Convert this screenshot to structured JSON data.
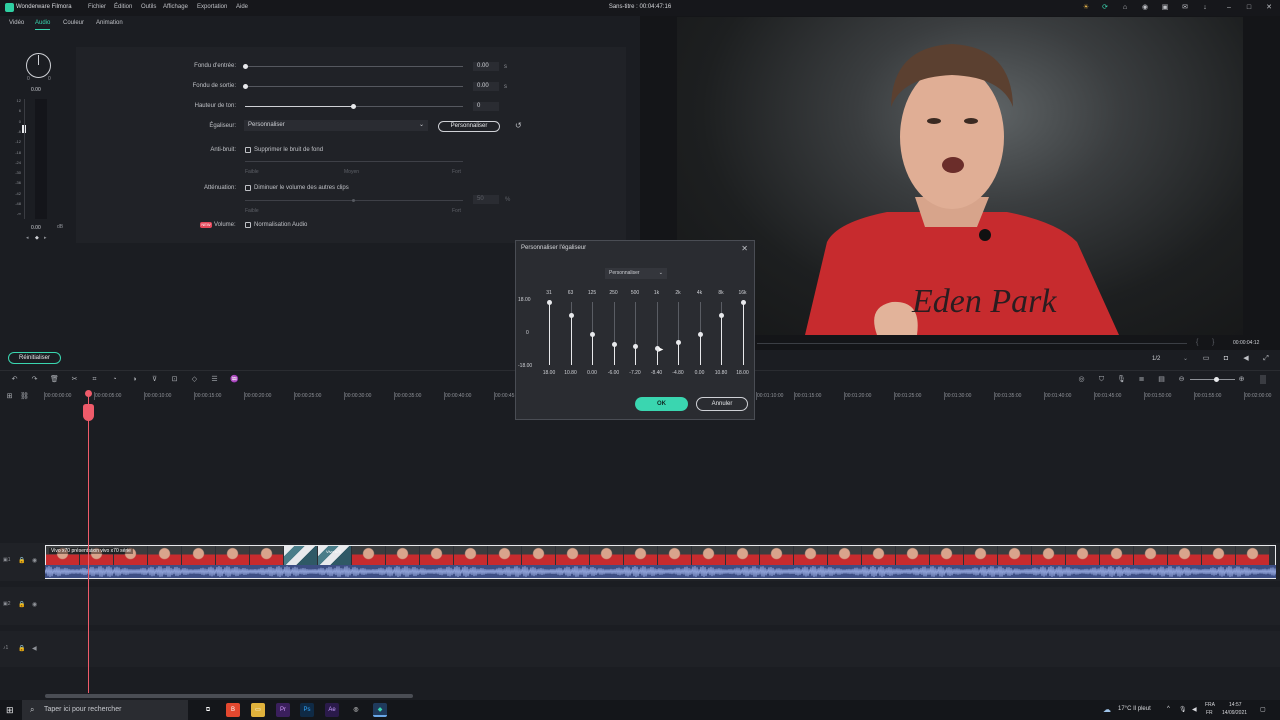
{
  "app": {
    "name": "Wonderware Filmora",
    "doc_title": "Sans-titre : 00:04:47:16",
    "menu": [
      "Fichier",
      "Édition",
      "Outils",
      "Affichage",
      "Exportation",
      "Aide"
    ]
  },
  "tabs": [
    "Vidéo",
    "Audio",
    "Couleur",
    "Animation"
  ],
  "active_tab": "Audio",
  "vu": {
    "value_top": "0.00",
    "value_bottom": "0.00",
    "db_unit": "dB",
    "scale": [
      "12",
      "6",
      "0",
      "-6",
      "-12",
      "-18",
      "-24",
      "-30",
      "-36",
      "-42",
      "-48",
      "-∞"
    ],
    "knob_left": "0",
    "knob_right": "0"
  },
  "audio": {
    "fade_in_label": "Fondu d'entrée:",
    "fade_in_value": "0.00",
    "fade_out_label": "Fondu de sortie:",
    "fade_out_value": "0.00",
    "seconds_unit": "s",
    "pitch_label": "Hauteur de ton:",
    "pitch_value": "0",
    "eq_label": "Égaliseur:",
    "eq_value": "Personnaliser",
    "eq_custom_button": "Personnaliser",
    "denoise_label": "Anti-bruit:",
    "denoise_checkbox": "Supprimer le bruit de fond",
    "denoise_scale": [
      "Faible",
      "Moyen",
      "Fort"
    ],
    "ducking_label": "Atténuation:",
    "ducking_checkbox": "Diminuer le volume des autres clips",
    "ducking_value": "50",
    "ducking_unit": "%",
    "ducking_scale": [
      "Faible",
      "Fort"
    ],
    "volume_badge": "NEW",
    "volume_label": "Volume:",
    "volume_checkbox": "Normalisation Audio",
    "reset_button": "Réinitialiser"
  },
  "preview": {
    "timecode": "00:00:04:12",
    "quality": "1/2",
    "shirt_text": "Eden Park"
  },
  "timeline": {
    "ticks": [
      "00:00:00:00",
      "00:00:05:00",
      "00:00:10:00",
      "00:00:15:00",
      "00:00:20:00",
      "00:00:25:00",
      "00:00:30:00",
      "00:00:35:00",
      "00:00:40:00",
      "00:00:45:00",
      "00:01:10:00",
      "00:01:15:00",
      "00:01:20:00",
      "00:01:25:00",
      "00:01:30:00",
      "00:01:35:00",
      "00:01:40:00",
      "00:01:45:00",
      "00:01:50:00",
      "00:01:55:00",
      "00:02:00:00"
    ],
    "clip_label": "Vivo x70 présentation vivo x70 série",
    "clip_label2": "Vivo x70"
  },
  "eq_dialog": {
    "title": "Personnaliser l'égaliseur",
    "preset": "Personnaliser",
    "ymax": "18.00",
    "ymid": "0",
    "ymin": "-18.00",
    "bands": [
      {
        "freq": "31",
        "gain": "18.00"
      },
      {
        "freq": "63",
        "gain": "10.80"
      },
      {
        "freq": "125",
        "gain": "0.00"
      },
      {
        "freq": "250",
        "gain": "-6.00"
      },
      {
        "freq": "500",
        "gain": "-7.20"
      },
      {
        "freq": "1k",
        "gain": "-8.40"
      },
      {
        "freq": "2k",
        "gain": "-4.80"
      },
      {
        "freq": "4k",
        "gain": "0.00"
      },
      {
        "freq": "8k",
        "gain": "10.80"
      },
      {
        "freq": "16k",
        "gain": "18.00"
      }
    ],
    "ok": "OK",
    "cancel": "Annuler"
  },
  "taskbar": {
    "search_placeholder": "Taper ici pour rechercher",
    "weather": "17°C  Il pleut",
    "lang1": "FRA",
    "lang2": "FR",
    "time": "14:57",
    "date": "14/09/2021"
  }
}
